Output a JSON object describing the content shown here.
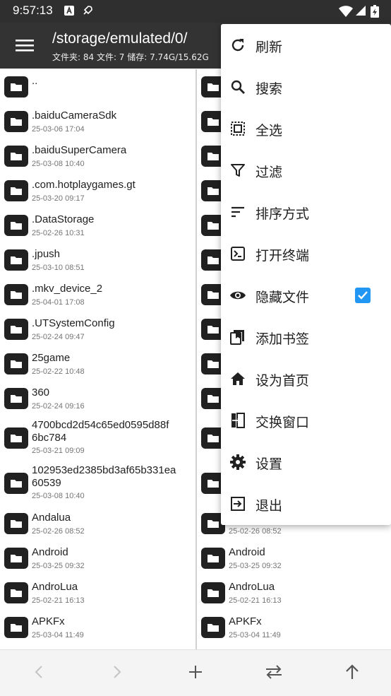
{
  "status": {
    "time": "9:57:13"
  },
  "header": {
    "path": "/storage/emulated/0/",
    "stats": "文件夹: 84  文件: 7  储存: 7.74G/15.62G"
  },
  "files": [
    {
      "name": "..",
      "date": ""
    },
    {
      "name": ".baiduCameraSdk",
      "date": "25-03-06 17:04"
    },
    {
      "name": ".baiduSuperCamera",
      "date": "25-03-08 10:40"
    },
    {
      "name": ".com.hotplaygames.gt",
      "date": "25-03-20 09:17"
    },
    {
      "name": ".DataStorage",
      "date": "25-02-26 10:31"
    },
    {
      "name": ".jpush",
      "date": "25-03-10 08:51"
    },
    {
      "name": ".mkv_device_2",
      "date": "25-04-01 17:08"
    },
    {
      "name": ".UTSystemConfig",
      "date": "25-02-24 09:47"
    },
    {
      "name": "25game",
      "date": "25-02-22 10:48"
    },
    {
      "name": "360",
      "date": "25-02-24 09:16"
    },
    {
      "name": "4700bcd2d54c65ed0595d88f",
      "name2": "6bc784",
      "date": "25-03-21 09:09"
    },
    {
      "name": "102953ed2385bd3af65b331ea",
      "name2": "60539",
      "date": "25-03-08 10:40"
    },
    {
      "name": "Andalua",
      "date": "25-02-26 08:52"
    },
    {
      "name": "Android",
      "date": "25-03-25 09:32"
    },
    {
      "name": "AndroLua",
      "date": "25-02-21 16:13"
    },
    {
      "name": "APKFx",
      "date": "25-03-04 11:49"
    }
  ],
  "menu": {
    "items": [
      {
        "label": "刷新",
        "icon": "refresh-icon"
      },
      {
        "label": "搜索",
        "icon": "search-icon"
      },
      {
        "label": "全选",
        "icon": "select-all-icon"
      },
      {
        "label": "过滤",
        "icon": "filter-icon"
      },
      {
        "label": "排序方式",
        "icon": "sort-icon"
      },
      {
        "label": "打开终端",
        "icon": "terminal-icon"
      },
      {
        "label": "隐藏文件",
        "icon": "eye-icon",
        "checked": true
      },
      {
        "label": "添加书签",
        "icon": "bookmark-icon"
      },
      {
        "label": "设为首页",
        "icon": "home-icon"
      },
      {
        "label": "交换窗口",
        "icon": "swap-window-icon"
      },
      {
        "label": "设置",
        "icon": "gear-icon"
      },
      {
        "label": "退出",
        "icon": "exit-icon"
      }
    ]
  },
  "colors": {
    "toolbar": "#333333",
    "statusbar": "#2f2f2f",
    "accent": "#2196f3"
  }
}
